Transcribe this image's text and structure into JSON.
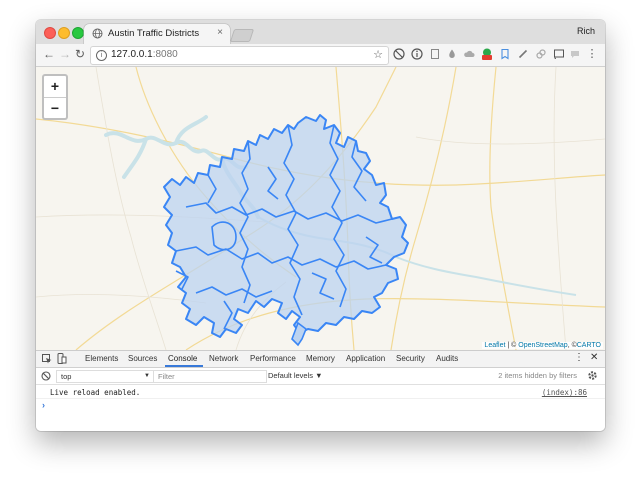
{
  "window": {
    "tab_title": "Austin Traffic Districts",
    "tab_close": "×",
    "profile_name": "Rich"
  },
  "toolbar": {
    "url_host": "127.0.0.1",
    "url_port": ":8080",
    "back_glyph": "←",
    "forward_glyph": "→",
    "reload_glyph": "↻",
    "star_glyph": "☆"
  },
  "map": {
    "zoom_in": "+",
    "zoom_out": "−",
    "attribution": {
      "leaflet": "Leaflet",
      "sep": " | © ",
      "osm": "OpenStreetMap",
      "sep2": ", ©",
      "carto": "CARTO"
    },
    "colors": {
      "district_stroke": "#3a86f5",
      "district_fill": "#bcd3f0",
      "water": "#cde6ec",
      "roads": "#f4d98a"
    }
  },
  "devtools": {
    "tabs": [
      "Elements",
      "Sources",
      "Console",
      "Network",
      "Performance",
      "Memory",
      "Application",
      "Security",
      "Audits"
    ],
    "active_tab": "Console",
    "context": "top",
    "filter_placeholder": "Filter",
    "levels": "Default levels ▼",
    "hidden_note": "2 items hidden by filters",
    "log_message": "Live reload enabled.",
    "log_source": "(index):86",
    "prompt": "›"
  }
}
